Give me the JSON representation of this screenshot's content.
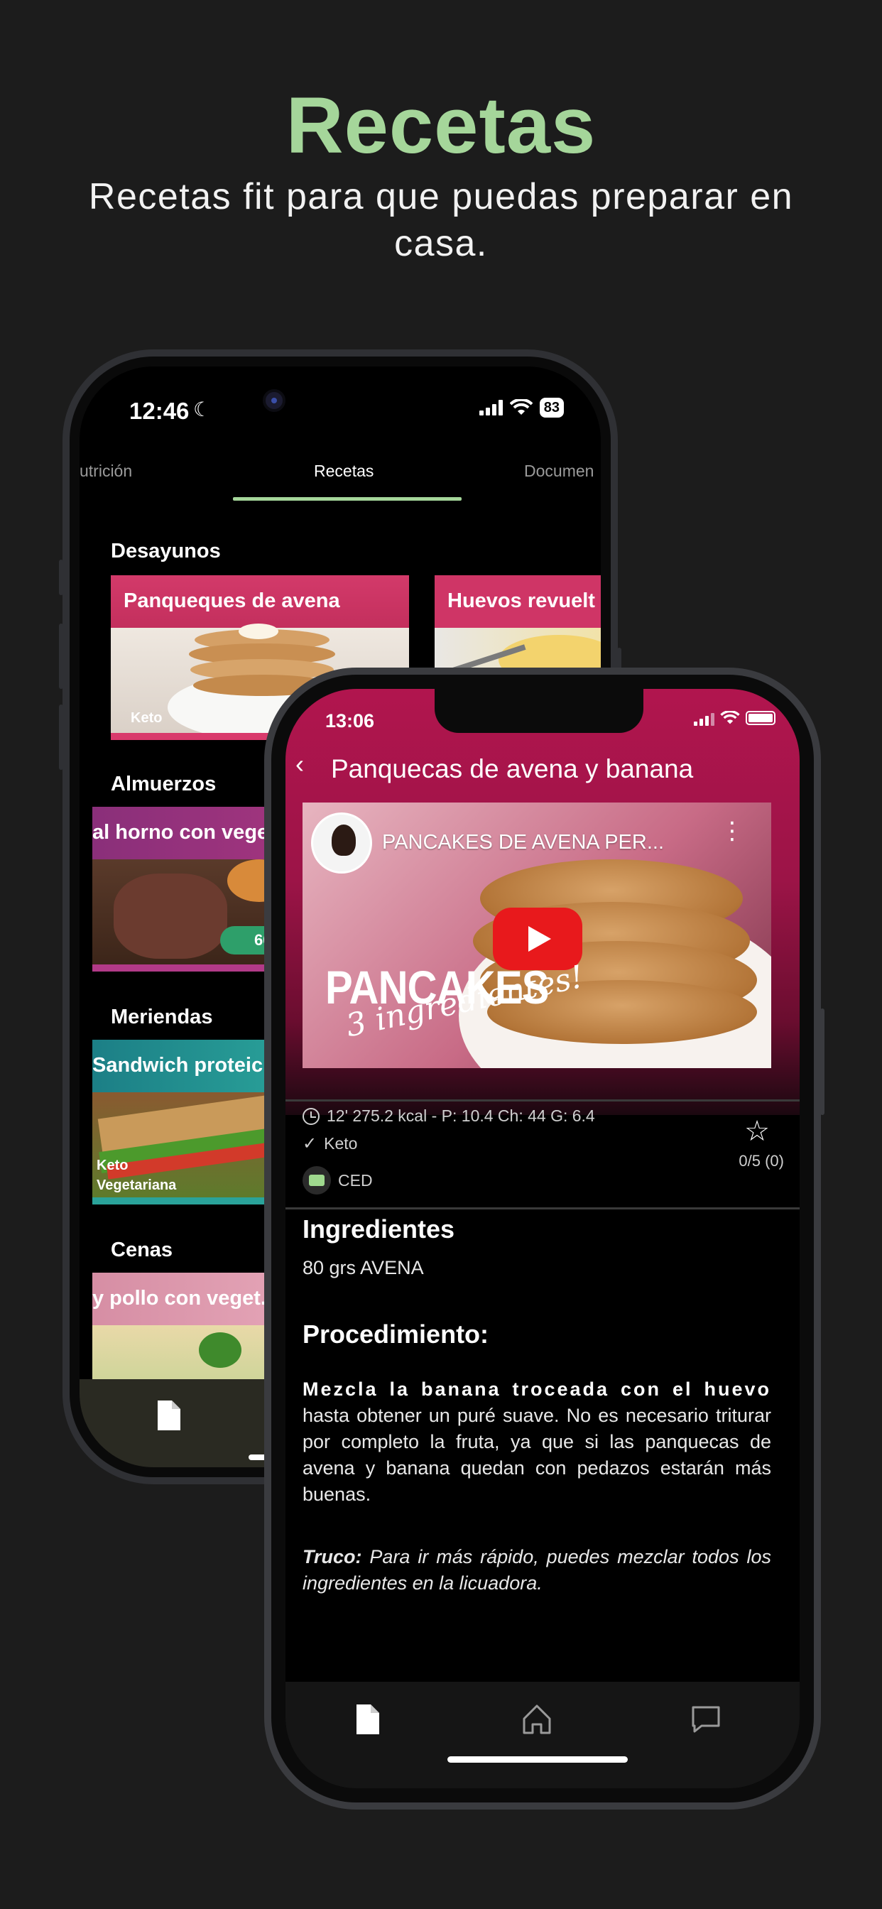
{
  "hero": {
    "title": "Recetas",
    "subtitle": "Recetas fit para que puedas preparar en casa."
  },
  "back_phone": {
    "status": {
      "time": "12:46",
      "battery": "83"
    },
    "tabs": [
      "utrición",
      "Recetas",
      "Documen"
    ],
    "sections": {
      "desayunos": "Desayunos",
      "almuerzos": "Almuerzos",
      "meriendas": "Meriendas",
      "cenas": "Cenas"
    },
    "cards": {
      "pancakes_title": "Panqueques de avena",
      "pancakes_tag": "Keto",
      "eggs_title": "Huevos revuelt",
      "roast_title": "al horno con veget",
      "roast_time": "60",
      "sandwich_title": "Sandwich proteic",
      "sandwich_tag1": "Keto",
      "sandwich_tag2": "Vegetariana",
      "chicken_title": "y pollo con veget."
    }
  },
  "front_phone": {
    "status": {
      "time": "13:06"
    },
    "header_title": "Panquecas de avena y banana",
    "video": {
      "title": "PANCAKES DE AVENA PER...",
      "big_text": "PANCAKES",
      "script_text": "3 ingredientes!"
    },
    "meta": {
      "nutrition": "12' 275.2 kcal - P: 10.4 Ch: 44 G: 6.4",
      "tag": "Keto",
      "badge": "CED",
      "rating": "0/5 (0)"
    },
    "ingredients_heading": "Ingredientes",
    "ingredients": [
      "80 grs AVENA"
    ],
    "procedure_heading": "Procedimiento:",
    "procedure": {
      "bold": "Mezcla la banana troceada con el huevo",
      "text": " hasta obtener un puré suave. No es necesario triturar por completo la fruta, ya que si las panquecas de avena y banana quedan con pedazos estarán más buenas."
    },
    "tip": {
      "label": "Truco:",
      "text": " Para ir más rápido, puedes mezclar todos los ingredientes en la licuadora."
    }
  },
  "colors": {
    "accent_green": "#a5d69a",
    "header_pink": "#b1154e",
    "background": "#1c1c1c"
  }
}
